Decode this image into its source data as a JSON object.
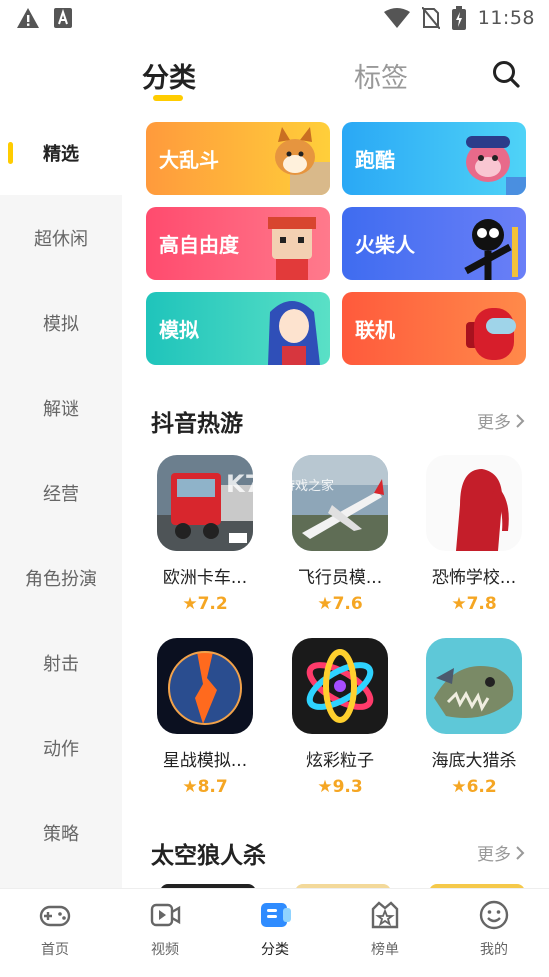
{
  "status_bar": {
    "time": "11:58",
    "icons": [
      "warning-icon",
      "a-icon",
      "wifi-icon",
      "no-sim-icon",
      "battery-icon"
    ]
  },
  "header": {
    "tabs": [
      {
        "label": "分类",
        "active": true
      },
      {
        "label": "标签",
        "active": false
      }
    ],
    "search_icon": "search-icon"
  },
  "sidebar": {
    "items": [
      {
        "label": "精选",
        "active": true
      },
      {
        "label": "超休闲",
        "active": false
      },
      {
        "label": "模拟",
        "active": false
      },
      {
        "label": "解谜",
        "active": false
      },
      {
        "label": "经营",
        "active": false
      },
      {
        "label": "角色扮演",
        "active": false
      },
      {
        "label": "射击",
        "active": false
      },
      {
        "label": "动作",
        "active": false
      },
      {
        "label": "策略",
        "active": false
      }
    ]
  },
  "categories": [
    {
      "label": "大乱斗",
      "color_from": "#ff9a3c",
      "color_to": "#ffcf3a"
    },
    {
      "label": "跑酷",
      "color_from": "#2aa8f5",
      "color_to": "#4fd3f7"
    },
    {
      "label": "高自由度",
      "color_from": "#ff4b6e",
      "color_to": "#ff7a8c"
    },
    {
      "label": "火柴人",
      "color_from": "#3f6cf0",
      "color_to": "#6a7ff7"
    },
    {
      "label": "模拟",
      "color_from": "#1fc4bb",
      "color_to": "#5ae0c6"
    },
    {
      "label": "联机",
      "color_from": "#ff5a3c",
      "color_to": "#ff8a4a"
    }
  ],
  "sections": [
    {
      "title": "抖音热游",
      "more": "更多",
      "games": [
        {
          "name": "欧洲卡车...",
          "rating": "7.2",
          "icon": "truck-icon"
        },
        {
          "name": "飞行员模...",
          "rating": "7.6",
          "icon": "airplane-icon"
        },
        {
          "name": "恐怖学校...",
          "rating": "7.8",
          "icon": "silhouette-icon"
        },
        {
          "name": "星战模拟...",
          "rating": "8.7",
          "icon": "planet-icon"
        },
        {
          "name": "炫彩粒子",
          "rating": "9.3",
          "icon": "atom-icon"
        },
        {
          "name": "海底大猎杀",
          "rating": "6.2",
          "icon": "fish-icon"
        }
      ]
    },
    {
      "title": "太空狼人杀",
      "more": "更多"
    }
  ],
  "watermark": "游戏之家",
  "bottom_nav": [
    {
      "label": "首页",
      "icon": "gamepad-icon",
      "active": false
    },
    {
      "label": "视频",
      "icon": "video-icon",
      "active": false
    },
    {
      "label": "分类",
      "icon": "category-icon",
      "active": true
    },
    {
      "label": "榜单",
      "icon": "ranking-icon",
      "active": false
    },
    {
      "label": "我的",
      "icon": "profile-icon",
      "active": false
    }
  ],
  "colors": {
    "accent": "#ffcc00",
    "rating": "#f5a623",
    "category_nav_active": "#2f8cff"
  }
}
